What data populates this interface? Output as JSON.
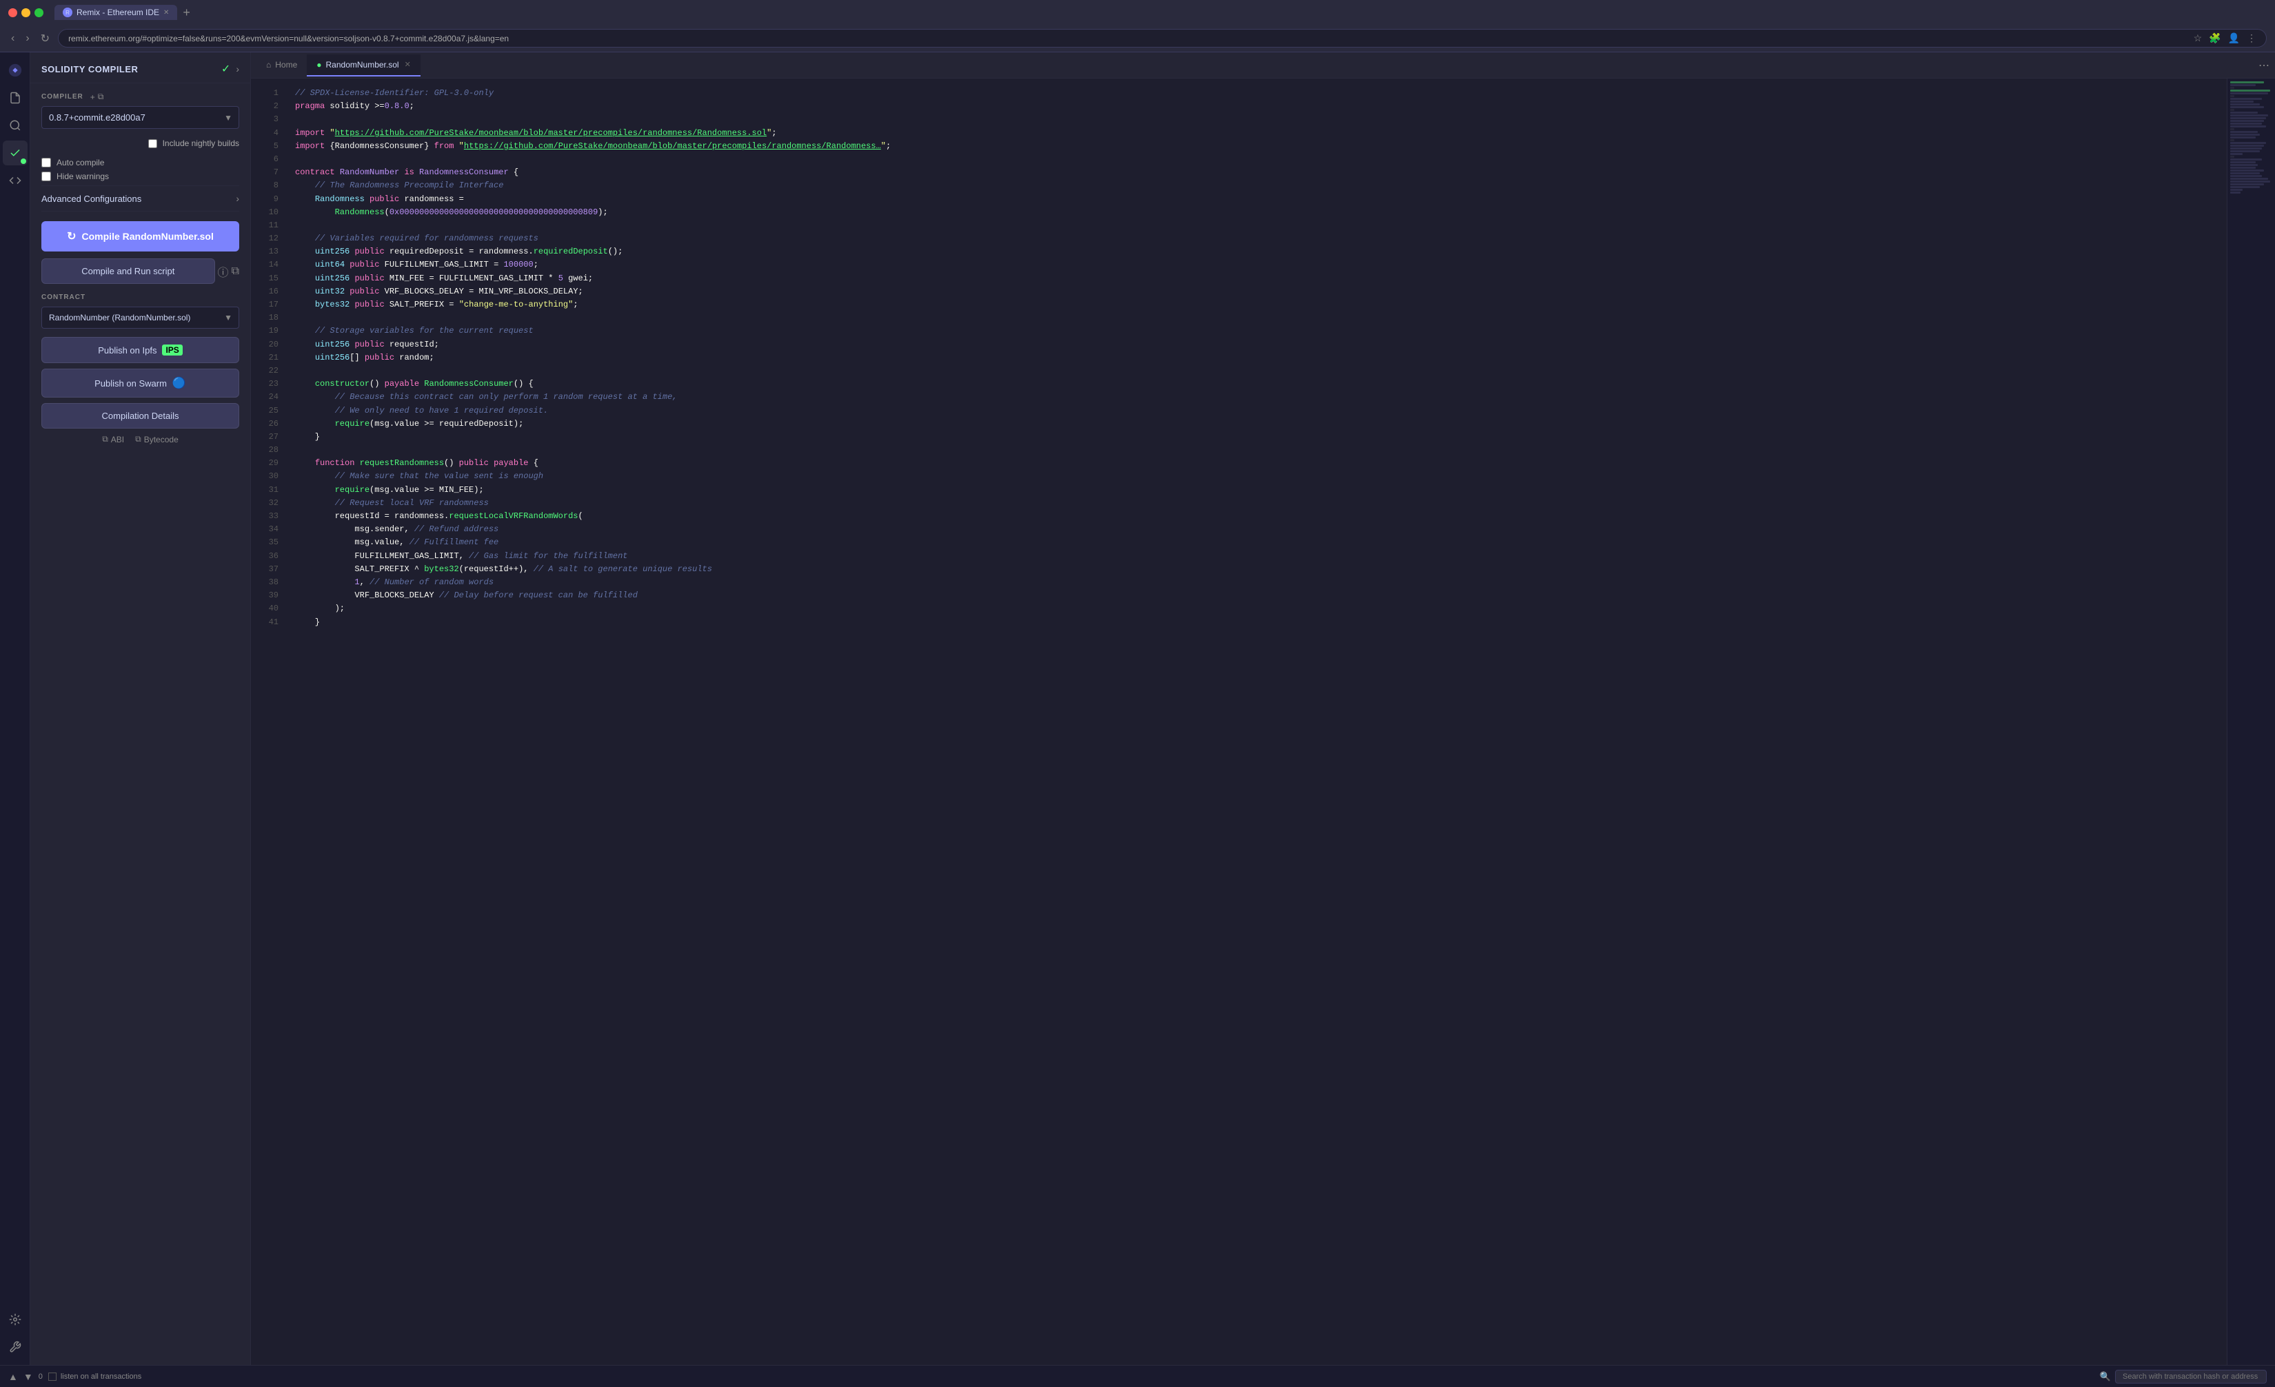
{
  "titlebar": {
    "traffic_lights": [
      "close",
      "minimize",
      "maximize"
    ],
    "tab_label": "Remix - Ethereum IDE",
    "new_tab_label": "+"
  },
  "addressbar": {
    "url": "remix.ethereum.org/#optimize=false&runs=200&evmVersion=null&version=soljson-v0.8.7+commit.e28d00a7.js&lang=en",
    "nav_back": "‹",
    "nav_forward": "›",
    "nav_refresh": "↻"
  },
  "sidebar": {
    "title": "SOLIDITY COMPILER",
    "compiler_label": "COMPILER",
    "compiler_version": "0.8.7+commit.e28d00a7",
    "include_nightly": "Include nightly builds",
    "auto_compile": "Auto compile",
    "hide_warnings": "Hide warnings",
    "advanced_config_label": "Advanced Configurations",
    "compile_btn_label": "Compile RandomNumber.sol",
    "compile_run_btn_label": "Compile and Run script",
    "contract_label": "CONTRACT",
    "contract_value": "RandomNumber (RandomNumber.sol)",
    "publish_ipfs_label": "Publish on Ipfs",
    "publish_swarm_label": "Publish on Swarm",
    "compilation_details_label": "Compilation Details",
    "abi_label": "ABI",
    "bytecode_label": "Bytecode"
  },
  "editor": {
    "home_tab": "Home",
    "file_tab": "RandomNumber.sol",
    "lines": [
      {
        "n": 1,
        "code": "// SPDX-License-Identifier: GPL-3.0-only",
        "type": "comment"
      },
      {
        "n": 2,
        "code": "pragma solidity >=0.8.0;",
        "type": "pragma"
      },
      {
        "n": 3,
        "code": "",
        "type": "blank"
      },
      {
        "n": 4,
        "code": "import \"https://github.com/PureStake/moonbeam/blob/master/precompiles/randomness/Randomness.sol\";",
        "type": "import"
      },
      {
        "n": 5,
        "code": "import {RandomnessConsumer} from \"https://github.com/PureStake/moonbeam/blob/master/precompiles/randomness/Randomness…\";",
        "type": "import"
      },
      {
        "n": 6,
        "code": "",
        "type": "blank"
      },
      {
        "n": 7,
        "code": "contract RandomNumber is RandomnessConsumer {",
        "type": "code"
      },
      {
        "n": 8,
        "code": "    // The Randomness Precompile Interface",
        "type": "comment"
      },
      {
        "n": 9,
        "code": "    Randomness public randomness =",
        "type": "code"
      },
      {
        "n": 10,
        "code": "        Randomness(0x0000000000000000000000000000000000000809);",
        "type": "code"
      },
      {
        "n": 11,
        "code": "",
        "type": "blank"
      },
      {
        "n": 12,
        "code": "    // Variables required for randomness requests",
        "type": "comment"
      },
      {
        "n": 13,
        "code": "    uint256 public requiredDeposit = randomness.requiredDeposit();",
        "type": "code"
      },
      {
        "n": 14,
        "code": "    uint64 public FULFILLMENT_GAS_LIMIT = 100000;",
        "type": "code"
      },
      {
        "n": 15,
        "code": "    uint256 public MIN_FEE = FULFILLMENT_GAS_LIMIT * 5 gwei;",
        "type": "code"
      },
      {
        "n": 16,
        "code": "    uint32 public VRF_BLOCKS_DELAY = MIN_VRF_BLOCKS_DELAY;",
        "type": "code"
      },
      {
        "n": 17,
        "code": "    bytes32 public SALT_PREFIX = \"change-me-to-anything\";",
        "type": "code"
      },
      {
        "n": 18,
        "code": "",
        "type": "blank"
      },
      {
        "n": 19,
        "code": "    // Storage variables for the current request",
        "type": "comment"
      },
      {
        "n": 20,
        "code": "    uint256 public requestId;",
        "type": "code"
      },
      {
        "n": 21,
        "code": "    uint256[] public random;",
        "type": "code"
      },
      {
        "n": 22,
        "code": "",
        "type": "blank"
      },
      {
        "n": 23,
        "code": "    constructor() payable RandomnessConsumer() {",
        "type": "code"
      },
      {
        "n": 24,
        "code": "        // Because this contract can only perform 1 random request at a time,",
        "type": "comment"
      },
      {
        "n": 25,
        "code": "        // We only need to have 1 required deposit.",
        "type": "comment"
      },
      {
        "n": 26,
        "code": "        require(msg.value >= requiredDeposit);",
        "type": "code"
      },
      {
        "n": 27,
        "code": "    }",
        "type": "code"
      },
      {
        "n": 28,
        "code": "",
        "type": "blank"
      },
      {
        "n": 29,
        "code": "    function requestRandomness() public payable {",
        "type": "code"
      },
      {
        "n": 30,
        "code": "        // Make sure that the value sent is enough",
        "type": "comment"
      },
      {
        "n": 31,
        "code": "        require(msg.value >= MIN_FEE);",
        "type": "code"
      },
      {
        "n": 32,
        "code": "        // Request local VRF randomness",
        "type": "comment"
      },
      {
        "n": 33,
        "code": "        requestId = randomness.requestLocalVRFRandomWords(",
        "type": "code"
      },
      {
        "n": 34,
        "code": "            msg.sender, // Refund address",
        "type": "code_comment"
      },
      {
        "n": 35,
        "code": "            msg.value, // Fulfillment fee",
        "type": "code_comment"
      },
      {
        "n": 36,
        "code": "            FULFILLMENT_GAS_LIMIT, // Gas limit for the fulfillment",
        "type": "code_comment"
      },
      {
        "n": 37,
        "code": "            SALT_PREFIX ^ bytes32(requestId++), // A salt to generate unique results",
        "type": "code_comment"
      },
      {
        "n": 38,
        "code": "            1, // Number of random words",
        "type": "code_comment"
      },
      {
        "n": 39,
        "code": "            VRF_BLOCKS_DELAY // Delay before request can be fulfilled",
        "type": "code_comment"
      },
      {
        "n": 40,
        "code": "        );",
        "type": "code"
      },
      {
        "n": 41,
        "code": "    }",
        "type": "code"
      }
    ]
  },
  "bottom_bar": {
    "transactions_label": "0",
    "listen_label": "listen on all transactions",
    "search_placeholder": "Search with transaction hash or address"
  },
  "icons": {
    "file_icon": "📄",
    "home_icon": "⌂",
    "search_icon": "🔍",
    "gear_icon": "⚙",
    "plugin_icon": "🔌",
    "git_icon": "⎇",
    "compile_icon": "✓",
    "deploy_icon": "▶",
    "swarm_icon": "🔵",
    "ipfs_icon": "📦",
    "refresh_icon": "↻",
    "copy_icon": "⧉",
    "info_icon": "ⓘ"
  }
}
